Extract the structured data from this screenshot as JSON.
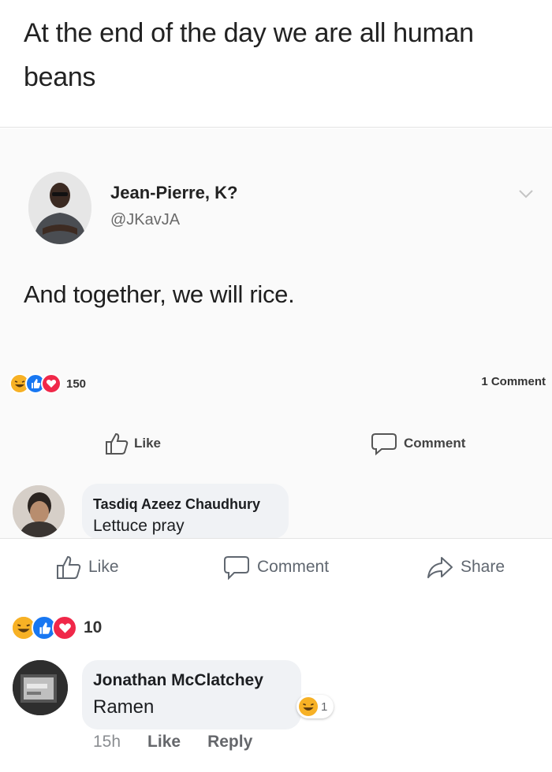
{
  "post": {
    "caption": "At the end of the day we are all human beans"
  },
  "tweet": {
    "author_name": "Jean-Pierre, K?",
    "author_handle": "@JKavJA",
    "text": "And together, we will rice.",
    "reaction_count": "150",
    "comment_count": "1 Comment",
    "like_label": "Like",
    "comment_label": "Comment",
    "reaction_icons": [
      "haha-icon",
      "like-icon",
      "love-icon"
    ]
  },
  "first_comment": {
    "author": "Tasdiq Azeez Chaudhury",
    "text": "Lettuce pray"
  },
  "actions": {
    "like_label": "Like",
    "comment_label": "Comment",
    "share_label": "Share"
  },
  "post_reactions": {
    "count": "10",
    "icons": [
      "haha-icon",
      "like-icon",
      "love-icon"
    ]
  },
  "second_comment": {
    "author": "Jonathan McClatchey",
    "text": "Ramen",
    "reaction_count": "1",
    "reaction_icon": "haha-icon",
    "time": "15h",
    "like_label": "Like",
    "reply_label": "Reply"
  },
  "colors": {
    "like_blue": "#1877f2",
    "love_red": "#f02849",
    "haha_yellow": "#f7b125",
    "bubble_gray": "#f0f2f5"
  }
}
